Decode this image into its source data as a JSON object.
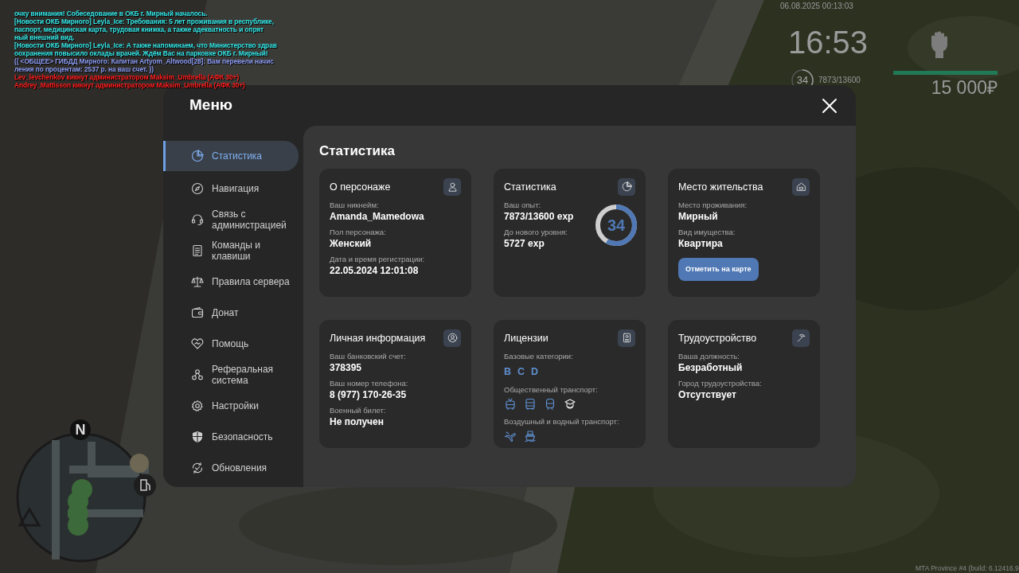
{
  "chat": [
    {
      "text": "очку внимания! Собеседование в ОКБ г. Мирный началось.",
      "kind": "news"
    },
    {
      "text": "[Новости ОКБ Мирного] Leyla_Ice: Требования: 5 лет проживания в республике,",
      "kind": "news"
    },
    {
      "text": "паспорт, медицинская карта, трудовая книжка, а также адекватность и опрят",
      "kind": "news"
    },
    {
      "text": "ный внешний вид.",
      "kind": "news"
    },
    {
      "text": "[Новости ОКБ Мирного] Leyla_Ice: А также напоминаем, что Министерство здрав",
      "kind": "news"
    },
    {
      "text": "оохранения повысило оклады врачей. Ждём Вас на парковке ОКБ г. Мирный!",
      "kind": "news"
    },
    {
      "text": "(( <ОБЩЕЕ> ГИБДД Мирного: Капитан Artyom_Altwood[28]: Вам перевели начис",
      "kind": "ooc"
    },
    {
      "text": "ления по процентам: 2537 р. на ваш счет. ))",
      "kind": "ooc"
    },
    {
      "text": "Lev_levchenkov кикнут администратором Maksim_Umbrella (АФК 30+)",
      "kind": "admin"
    },
    {
      "text": "Andrey_Mattisson кикнут администратором Maksim_Umbrella (АФК 30+)",
      "kind": "admin"
    }
  ],
  "hud": {
    "datetime": "06.08.2025 00:13:03",
    "clock": "16:53",
    "level_badge": {
      "text": "34"
    },
    "exp": "7873/13600",
    "money": "15 000₽"
  },
  "minimap": {
    "north": "N"
  },
  "menu": {
    "title": "Меню",
    "sidebar": [
      {
        "label": "Статистика",
        "selected": true
      },
      {
        "label": "Навигация",
        "selected": false
      },
      {
        "label": "Связь с администрацией",
        "selected": false
      },
      {
        "label": "Команды и клавиши",
        "selected": false
      },
      {
        "label": "Правила сервера",
        "selected": false
      },
      {
        "label": "Донат",
        "selected": false
      },
      {
        "label": "Помощь",
        "selected": false
      },
      {
        "label": "Реферальная система",
        "selected": false
      },
      {
        "label": "Настройки",
        "selected": false
      },
      {
        "label": "Безопасность",
        "selected": false
      },
      {
        "label": "Обновления",
        "selected": false
      }
    ],
    "page_title": "Статистика",
    "cards": [
      {
        "title": "О персонаже",
        "fields": [
          {
            "kind": "text",
            "label": "Ваш никнейм:",
            "value": "Amanda_Mamedowa"
          },
          {
            "kind": "text",
            "label": "Пол персонажа:",
            "value": "Женский"
          },
          {
            "kind": "text",
            "label": "Дата и время регистрации:",
            "value": "22.05.2024 12:01:08"
          }
        ]
      },
      {
        "title": "Статистика",
        "fields": [
          {
            "kind": "text",
            "label": "Ваш опыт:",
            "value": "7873/13600 exp"
          },
          {
            "kind": "text",
            "label": "До нового уровня:",
            "value": "5727 exp"
          }
        ],
        "ring": {
          "text": "34"
        }
      },
      {
        "title": "Место жительства",
        "fields": [
          {
            "kind": "text",
            "label": "Место проживания:",
            "value": "Мирный"
          },
          {
            "kind": "text",
            "label": "Вид имущества:",
            "value": "Квартира"
          }
        ],
        "button": "Отметить на карте"
      },
      {
        "title": "Личная информация",
        "fields": [
          {
            "kind": "text",
            "label": "Ваш банковский счет:",
            "value": "378395"
          },
          {
            "kind": "text",
            "label": "Ваш номер телефона:",
            "value": "8 (977) 170-26-35"
          },
          {
            "kind": "text",
            "label": "Военный билет:",
            "value": "Не получен"
          }
        ]
      },
      {
        "title": "Лицензии",
        "fields": [
          {
            "kind": "letters",
            "label": "Базовые категории:",
            "items": [
              "B",
              "C",
              "D"
            ]
          },
          {
            "kind": "icons",
            "label": "Общественный транспорт:",
            "items": [
              {
                "owned": true
              },
              {
                "owned": true
              },
              {
                "owned": true
              },
              {
                "owned": false
              }
            ]
          },
          {
            "kind": "icons",
            "label": "Воздушный и водный транспорт:",
            "items": [
              {
                "owned": true
              },
              {
                "owned": true
              }
            ]
          }
        ]
      },
      {
        "title": "Трудоустройство",
        "fields": [
          {
            "kind": "text",
            "label": "Ваша должность:",
            "value": "Безработный"
          },
          {
            "kind": "text",
            "label": "Город трудоустройства:",
            "value": "Отсутствует"
          }
        ]
      }
    ]
  },
  "build": "MTA Province #4 (build: 6.12416.9"
}
